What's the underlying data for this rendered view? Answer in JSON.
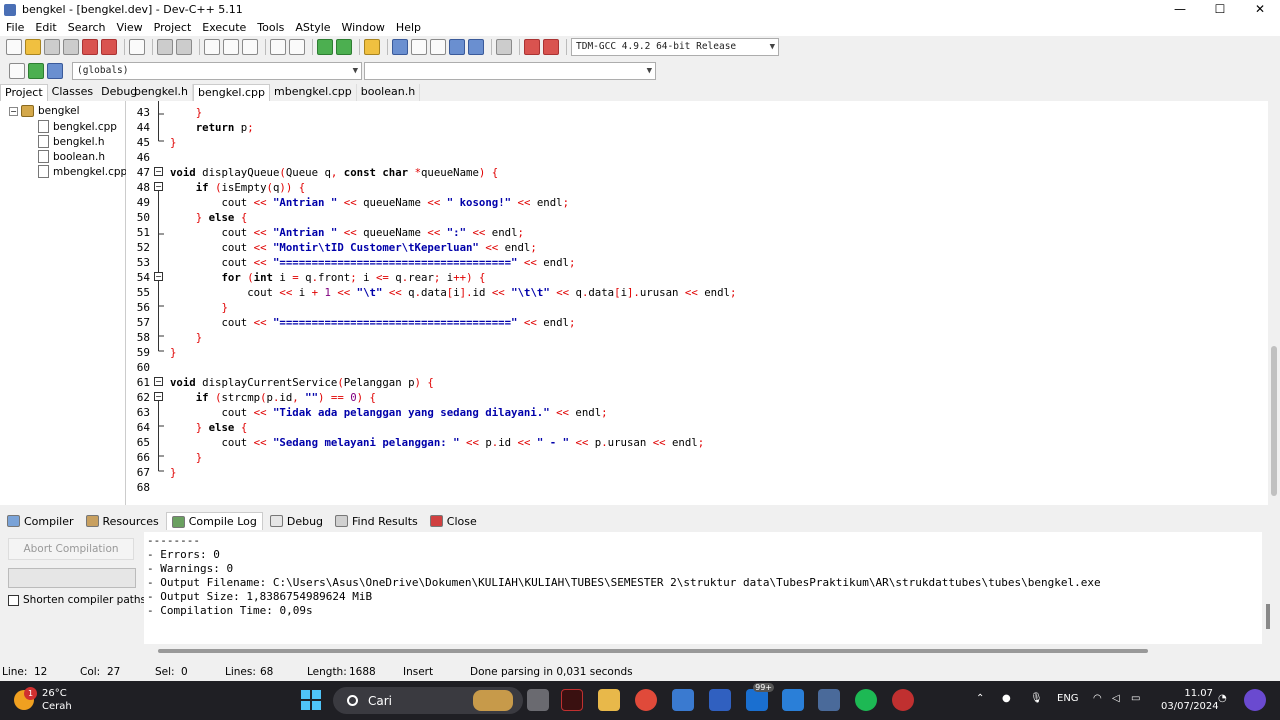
{
  "window": {
    "title": "bengkel - [bengkel.dev] - Dev-C++ 5.11",
    "min": "—",
    "max": "☐",
    "close": "✕"
  },
  "menu": [
    "File",
    "Edit",
    "Search",
    "View",
    "Project",
    "Execute",
    "Tools",
    "AStyle",
    "Window",
    "Help"
  ],
  "toolbar": {
    "compiler_select": "TDM-GCC 4.9.2 64-bit Release"
  },
  "toolbar2": {
    "scope_select": "(globals)",
    "member_select": ""
  },
  "left_tabs": [
    "Project",
    "Classes",
    "Debug"
  ],
  "file_tabs": [
    "bengkel.h",
    "bengkel.cpp",
    "mbengkel.cpp",
    "boolean.h"
  ],
  "active_file_tab": "bengkel.cpp",
  "project": {
    "root": "bengkel",
    "expander": "−",
    "files": [
      "bengkel.cpp",
      "bengkel.h",
      "boolean.h",
      "mbengkel.cpp"
    ]
  },
  "editor": {
    "line_numbers": [
      "43",
      "44",
      "45",
      "46",
      "47",
      "48",
      "49",
      "50",
      "51",
      "52",
      "53",
      "54",
      "55",
      "56",
      "57",
      "58",
      "59",
      "60",
      "61",
      "62",
      "63",
      "64",
      "65",
      "66",
      "67",
      "68"
    ],
    "fold_sign": "−"
  },
  "bottom_tabs": [
    "Compiler",
    "Resources",
    "Compile Log",
    "Debug",
    "Find Results",
    "Close"
  ],
  "active_bottom_tab": "Compile Log",
  "compile_panel": {
    "abort_label": "Abort Compilation",
    "shorten_label": "Shorten compiler paths",
    "log": [
      "--------",
      "- Errors: 0",
      "- Warnings: 0",
      "- Output Filename: C:\\Users\\Asus\\OneDrive\\Dokumen\\KULIAH\\KULIAH\\TUBES\\SEMESTER 2\\struktur data\\TubesPraktikum\\AR\\strukdattubes\\tubes\\bengkel.exe",
      "- Output Size: 1,8386754989624 MiB",
      "- Compilation Time: 0,09s"
    ]
  },
  "statusbar": {
    "line_label": "Line:",
    "line": "12",
    "col_label": "Col:",
    "col": "27",
    "sel_label": "Sel:",
    "sel": "0",
    "lines_label": "Lines:",
    "lines": "68",
    "length_label": "Length:",
    "length": "1688",
    "mode": "Insert",
    "message": "Done parsing in 0,031 seconds"
  },
  "taskbar": {
    "temperature": "26°C",
    "weather": "Cerah",
    "weather_badge": "1",
    "search_label": "Cari",
    "app_badge": "99+",
    "language": "ENG",
    "time": "11.07",
    "date": "03/07/2024"
  }
}
